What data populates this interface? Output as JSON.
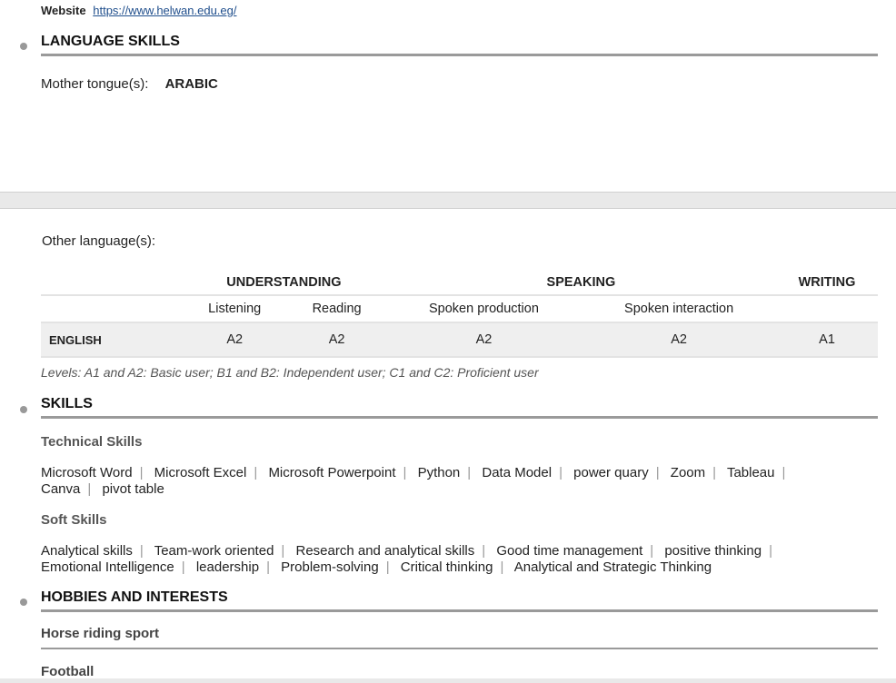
{
  "website": {
    "label": "Website",
    "url": "https://www.helwan.edu.eg/"
  },
  "language_skills": {
    "title": "LANGUAGE SKILLS",
    "mother_label": "Mother tongue(s):",
    "mother_value": "ARABIC",
    "other_label": "Other language(s):",
    "groups": [
      "UNDERSTANDING",
      "SPEAKING",
      "WRITING"
    ],
    "subheaders": [
      "Listening",
      "Reading",
      "Spoken production",
      "Spoken interaction"
    ],
    "rows": [
      {
        "language": "ENGLISH",
        "values": [
          "A2",
          "A2",
          "A2",
          "A2",
          "A1"
        ]
      }
    ],
    "levels_note": "Levels: A1 and A2: Basic user; B1 and B2: Independent user; C1 and C2: Proficient user"
  },
  "skills": {
    "title": "SKILLS",
    "technical_title": "Technical Skills",
    "technical": [
      "Microsoft Word",
      "Microsoft Excel",
      "Microsoft Powerpoint",
      "Python",
      "Data Model",
      "power quary",
      "Zoom",
      "Tableau",
      "Canva",
      "pivot table"
    ],
    "soft_title": "Soft Skills",
    "soft": [
      "Analytical skills",
      "Team-work oriented",
      "Research and analytical skills",
      "Good time management",
      "positive thinking",
      "Emotional Intelligence",
      "leadership",
      "Problem-solving",
      "Critical thinking",
      "Analytical and Strategic Thinking"
    ]
  },
  "hobbies": {
    "title": "HOBBIES AND INTERESTS",
    "items": [
      "Horse riding sport",
      "Football"
    ]
  }
}
